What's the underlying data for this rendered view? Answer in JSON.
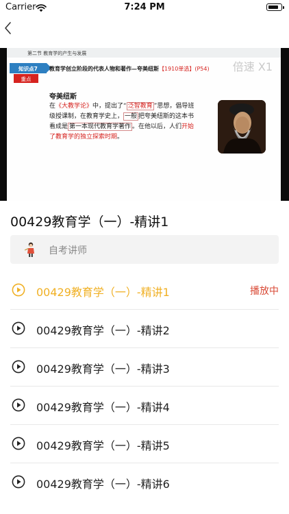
{
  "status_bar": {
    "carrier": "Carrier",
    "time": "7:24 PM"
  },
  "video": {
    "slide_section": "第二节  教育学的产生与发展",
    "knowledge_point_badge": "知识点7",
    "key_badge": "重点",
    "slide_title": "教育学创立阶段的代表人物和著作—夸美纽斯",
    "slide_title_note": "【1910单选】(P54)",
    "speed_label": "倍速 X1",
    "person_name": "夸美纽斯",
    "body": {
      "t1": "在",
      "t2": "《大教学论》",
      "t3": "中，提出了“",
      "t4": "泛智教育",
      "t5": "”思想，倡导班级授课制，在教育学史上，",
      "t6": "一般",
      "t7": "把夸美纽斯的这本书看成是",
      "t8": "第一本现代教育学著作",
      "t9": "。在他以后，人们",
      "t10": "开始了教育学的独立探索时期",
      "t11": "。"
    }
  },
  "course": {
    "title": "00429教育学（一）-精讲1"
  },
  "teacher": {
    "name": "自考讲师",
    "avatar_icon": "teacher-avatar"
  },
  "lessons": [
    {
      "label": "00429教育学（一）-精讲1",
      "status": "播放中",
      "active": true
    },
    {
      "label": "00429教育学（一）-精讲2",
      "status": "",
      "active": false
    },
    {
      "label": "00429教育学（一）-精讲3",
      "status": "",
      "active": false
    },
    {
      "label": "00429教育学（一）-精讲4",
      "status": "",
      "active": false
    },
    {
      "label": "00429教育学（一）-精讲5",
      "status": "",
      "active": false
    },
    {
      "label": "00429教育学（一）-精讲6",
      "status": "",
      "active": false
    }
  ],
  "colors": {
    "active": "#f0b024",
    "playing_status": "#d94a36",
    "icon": "#222222"
  }
}
